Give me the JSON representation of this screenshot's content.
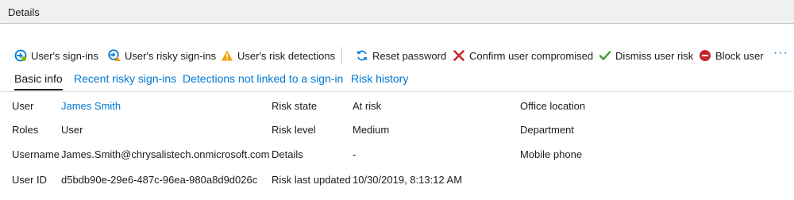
{
  "header": {
    "title": "Details"
  },
  "toolbar": {
    "user_signins": "User's sign-ins",
    "user_risky_signins": "User's risky sign-ins",
    "user_risk_detections": "User's risk detections",
    "reset_password": "Reset password",
    "confirm_compromised": "Confirm user compromised",
    "dismiss_risk": "Dismiss user risk",
    "block_user": "Block user",
    "more": "···"
  },
  "tabs": {
    "basic_info": "Basic info",
    "recent_risky_signins": "Recent risky sign-ins",
    "detections_not_linked": "Detections not linked to a sign-in",
    "risk_history": "Risk history"
  },
  "details": {
    "user_label": "User",
    "user_value": "James Smith",
    "roles_label": "Roles",
    "roles_value": "User",
    "username_label": "Username",
    "username_value": "James.Smith@chrysalistech.onmicrosoft.com",
    "userid_label": "User ID",
    "userid_value": "d5bdb90e-29e6-487c-96ea-980a8d9d026c",
    "risk_state_label": "Risk state",
    "risk_state_value": "At risk",
    "risk_level_label": "Risk level",
    "risk_level_value": "Medium",
    "details_label": "Details",
    "details_value": "-",
    "risk_last_updated_label": "Risk last updated",
    "risk_last_updated_value": "10/30/2019, 8:13:12 AM",
    "office_location_label": "Office location",
    "department_label": "Department",
    "mobile_phone_label": "Mobile phone"
  },
  "colors": {
    "accent": "#0078d4",
    "warning": "#f2a20c",
    "danger": "#c4262e",
    "success": "#3a9a2d",
    "header_bg": "#f0f0f0"
  },
  "icons": [
    "signin-icon",
    "risky-signin-icon",
    "warning-icon",
    "refresh-icon",
    "x-icon",
    "checkmark-icon",
    "block-icon",
    "more-icon"
  ]
}
